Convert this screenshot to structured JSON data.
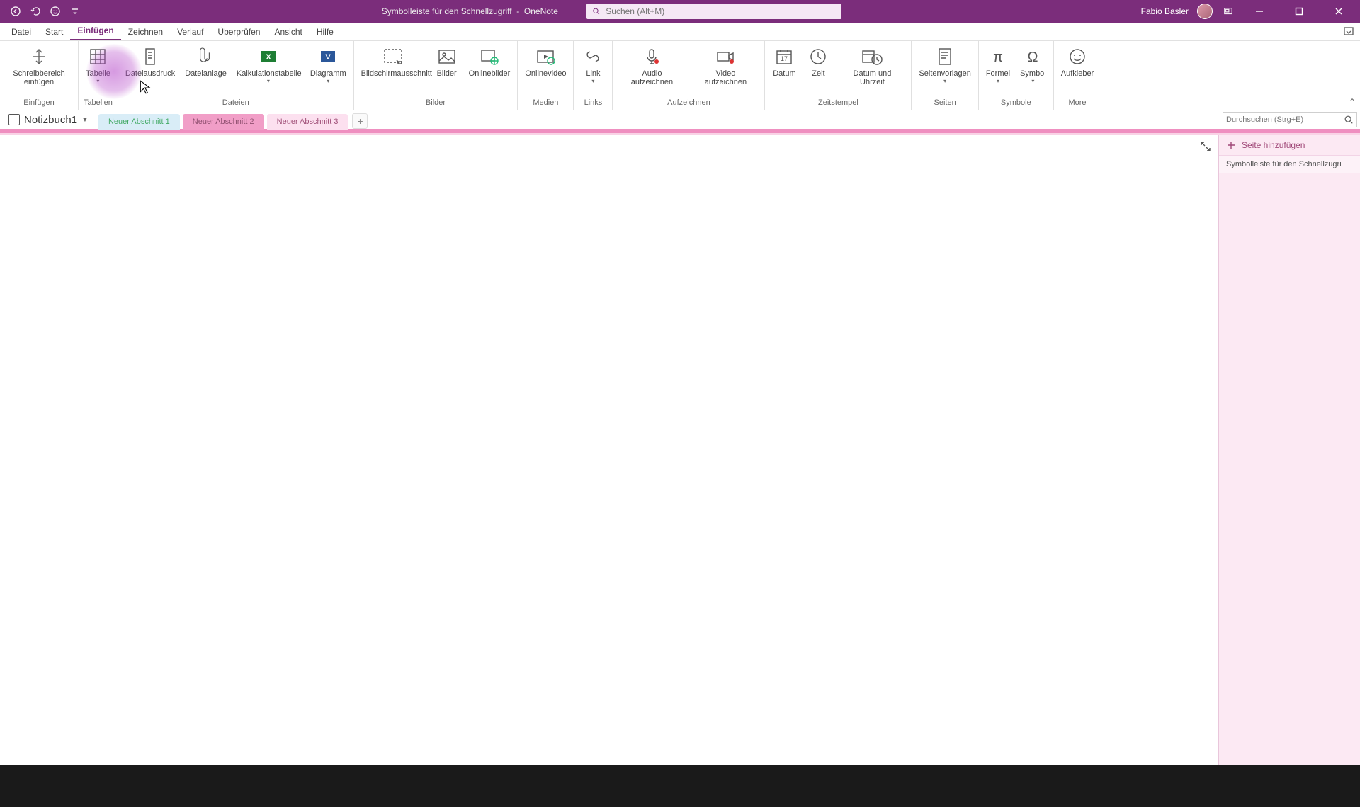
{
  "titlebar": {
    "title_left": "Symbolleiste für den Schnellzugriff",
    "title_sep": "-",
    "app_name": "OneNote",
    "search_placeholder": "Suchen (Alt+M)",
    "user": "Fabio Basler"
  },
  "tabs": {
    "datei": "Datei",
    "start": "Start",
    "einfuegen": "Einfügen",
    "zeichnen": "Zeichnen",
    "verlauf": "Verlauf",
    "ueberpruefen": "Überprüfen",
    "ansicht": "Ansicht",
    "hilfe": "Hilfe"
  },
  "ribbon": {
    "groups": {
      "einfuegen": "Einfügen",
      "tabellen": "Tabellen",
      "dateien": "Dateien",
      "bilder": "Bilder",
      "medien": "Medien",
      "links": "Links",
      "aufzeichnen": "Aufzeichnen",
      "zeitstempel": "Zeitstempel",
      "seiten": "Seiten",
      "symbole": "Symbole",
      "more": "More"
    },
    "buttons": {
      "schreibbereich": "Schreibbereich einfügen",
      "tabelle": "Tabelle",
      "dateiausdruck": "Dateiausdruck",
      "dateianlage": "Dateianlage",
      "kalkulationstabelle": "Kalkulationstabelle",
      "diagramm": "Diagramm",
      "bildschirmausschnitt": "Bildschirmausschnitt",
      "bilder": "Bilder",
      "onlinebilder": "Onlinebilder",
      "onlinevideo": "Onlinevideo",
      "link": "Link",
      "audio": "Audio aufzeichnen",
      "video": "Video aufzeichnen",
      "datum": "Datum",
      "zeit": "Zeit",
      "datum_uhrzeit": "Datum und Uhrzeit",
      "seitenvorlagen": "Seitenvorlagen",
      "formel": "Formel",
      "symbol": "Symbol",
      "aufkleber": "Aufkleber"
    }
  },
  "notebook": {
    "name": "Notizbuch1"
  },
  "sections": {
    "s1": "Neuer Abschnitt 1",
    "s2": "Neuer Abschnitt 2",
    "s3": "Neuer Abschnitt 3"
  },
  "page_search_placeholder": "Durchsuchen (Strg+E)",
  "page_panel": {
    "add": "Seite hinzufügen",
    "page1": "Symbolleiste für den Schnellzugri"
  }
}
